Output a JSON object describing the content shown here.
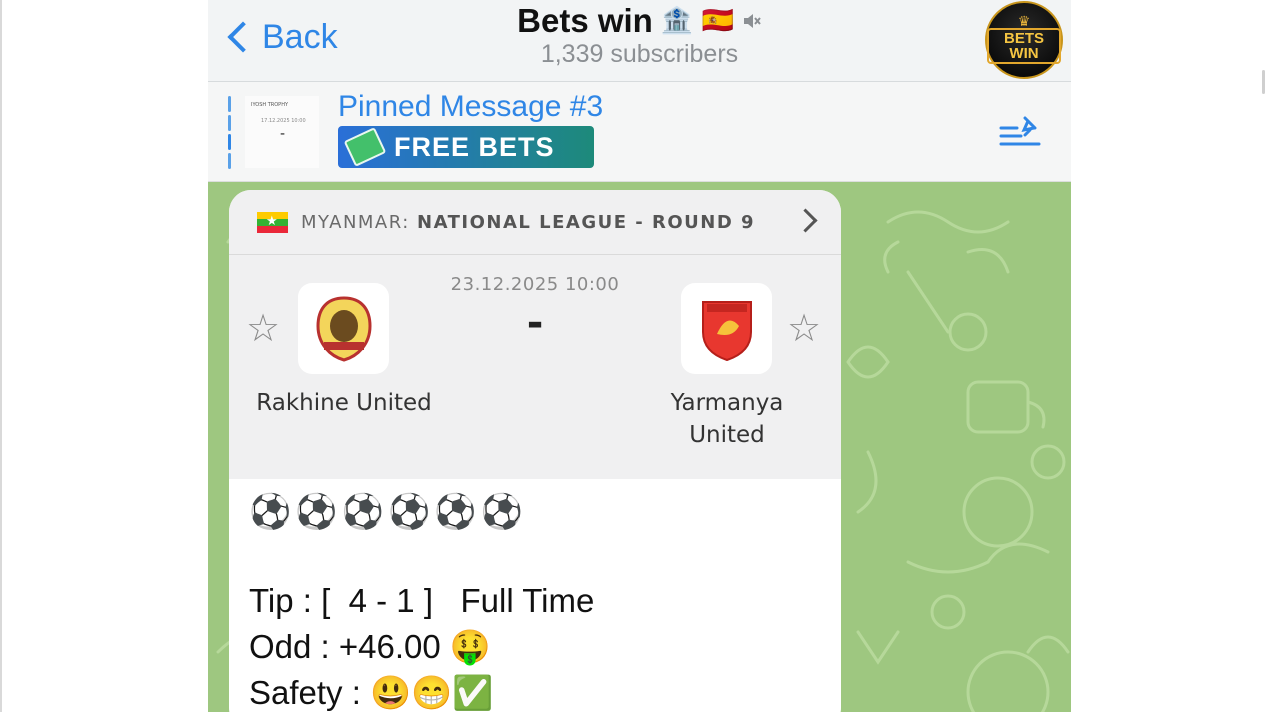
{
  "header": {
    "back_label": "Back",
    "title": "Bets win",
    "title_emojis": "🏦 🇪🇸",
    "subscribers": "1,339 subscribers",
    "avatar_text": "BETS WIN",
    "avatar_crown": "♛"
  },
  "pinned": {
    "title": "Pinned Message #3",
    "banner_label": "FREE BETS",
    "thumb_line1": "IYOSH TROPHY",
    "thumb_line2": "17.12.2025 10:00",
    "thumb_line3": "-"
  },
  "match": {
    "league_country": "MYANMAR:",
    "league_name": "NATIONAL LEAGUE - ROUND 9",
    "date": "23.12.2025 10:00",
    "score": "-",
    "home_team": "Rakhine United",
    "away_team": "Yarmanya United",
    "star_glyph": "☆",
    "flag_star": "★"
  },
  "message": {
    "balls": "⚽⚽⚽⚽⚽⚽",
    "tip": "Tip : [  4 - 1 ]   Full Time",
    "odd": "Odd : +46.00 🤑",
    "safety": "Safety : 😃😁✅"
  },
  "colors": {
    "accent": "#2f86e6",
    "wallpaper": "#9ec780",
    "header_bg": "#f2f4f5"
  }
}
